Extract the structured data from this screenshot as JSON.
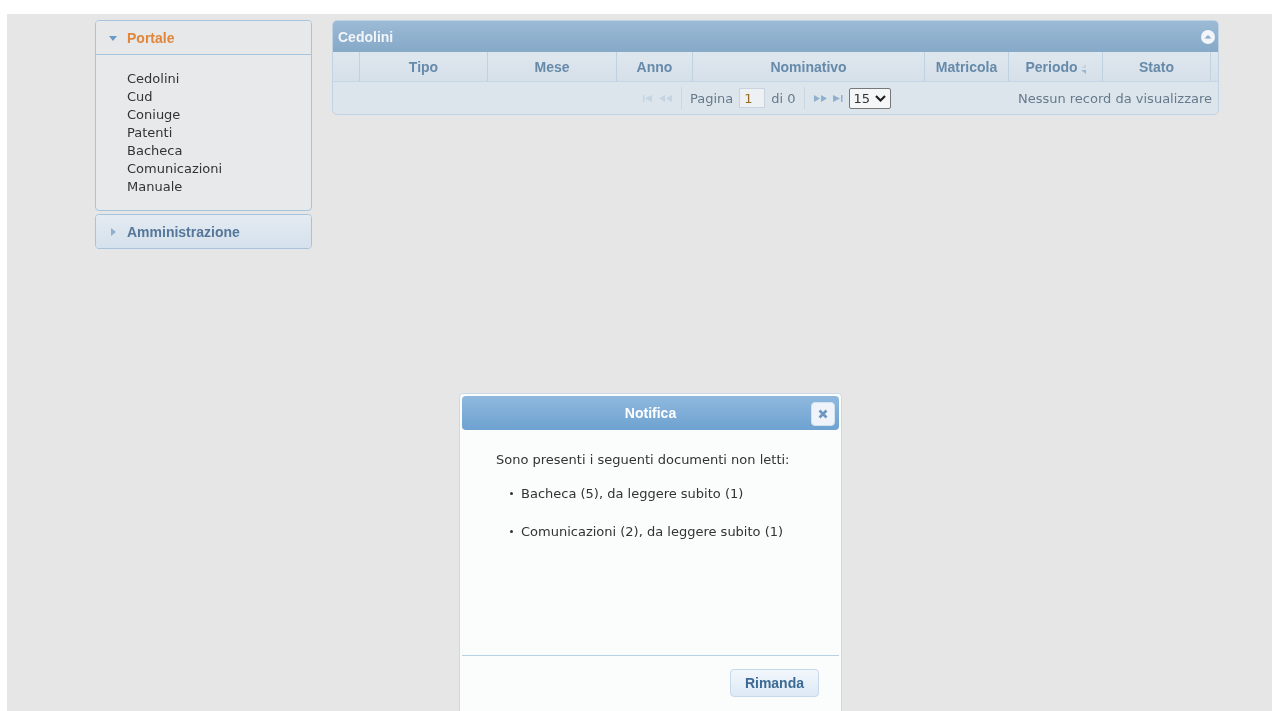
{
  "sidebar": {
    "sections": [
      {
        "title": "Portale",
        "expanded": true,
        "items": [
          "Cedolini",
          "Cud",
          "Coniuge",
          "Patenti",
          "Bacheca",
          "Comunicazioni",
          "Manuale"
        ]
      },
      {
        "title": "Amministrazione",
        "expanded": false
      }
    ]
  },
  "grid": {
    "title": "Cedolini",
    "columns": [
      {
        "label": "Tipo",
        "sortable": false
      },
      {
        "label": "Mese",
        "sortable": false
      },
      {
        "label": "Anno",
        "sortable": false
      },
      {
        "label": "Nominativo",
        "sortable": false
      },
      {
        "label": "Matricola",
        "sortable": false
      },
      {
        "label": "Periodo",
        "sortable": true
      },
      {
        "label": "Stato",
        "sortable": false
      }
    ],
    "pager": {
      "page_label": "Pagina",
      "page": "1",
      "of": "di 0",
      "page_size": "15",
      "message": "Nessun record da visualizzare"
    }
  },
  "dialog": {
    "title": "Notifica",
    "intro": "Sono presenti i seguenti documenti non letti:",
    "items": [
      "Bacheca (5), da leggere subito (1)",
      "Comunicazioni (2), da leggere subito (1)"
    ],
    "button": "Rimanda"
  }
}
